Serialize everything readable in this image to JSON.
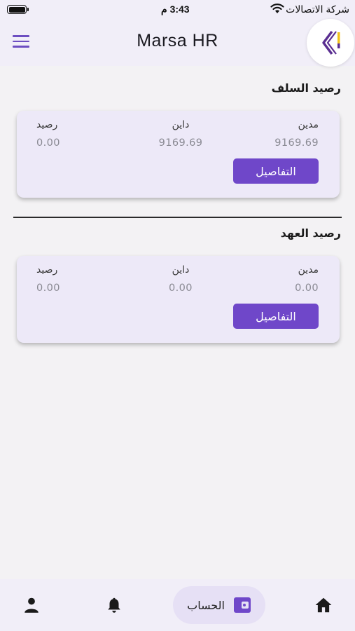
{
  "status_bar": {
    "carrier": "شركة الاتصالات",
    "time": "3:43 م"
  },
  "header": {
    "title": "Marsa HR"
  },
  "advances": {
    "title": "رصيد السلف",
    "debit_label": "مدين",
    "debit_value": "9169.69",
    "credit_label": "داين",
    "credit_value": "9169.69",
    "balance_label": "رصيد",
    "balance_value": "0.00",
    "details_label": "التفاصيل"
  },
  "custody": {
    "title": "رصيد العهد",
    "debit_label": "مدين",
    "debit_value": "0.00",
    "credit_label": "داين",
    "credit_value": "0.00",
    "balance_label": "رصيد",
    "balance_value": "0.00",
    "details_label": "التفاصيل"
  },
  "bottom_nav": {
    "active_label": "الحساب",
    "items": [
      "home-icon",
      "wallet-icon",
      "bell-icon",
      "person-icon"
    ]
  },
  "colors": {
    "accent": "#6f47c9",
    "card_bg": "#ede9f8",
    "logo_gold": "#f2c21b",
    "logo_purple": "#5a2e91"
  }
}
